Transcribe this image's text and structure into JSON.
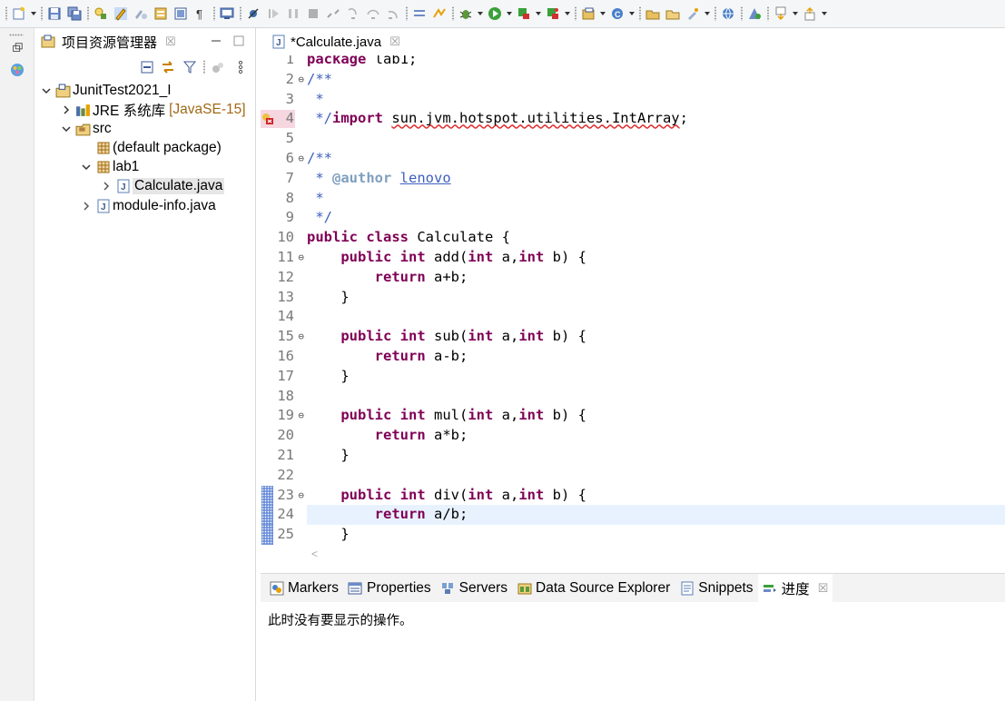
{
  "explorer": {
    "title": "项目资源管理器",
    "close": "☒"
  },
  "tree": [
    {
      "label": "JunitTest2021_I",
      "deco": ""
    },
    {
      "label": "JRE 系统库",
      "deco": "[JavaSE-15]"
    },
    {
      "label": "src",
      "deco": ""
    },
    {
      "label": "(default package)",
      "deco": ""
    },
    {
      "label": "lab1",
      "deco": ""
    },
    {
      "label": "Calculate.java",
      "deco": ""
    },
    {
      "label": "module-info.java",
      "deco": ""
    }
  ],
  "editor": {
    "tab_label": "*Calculate.java",
    "close": "☒",
    "lines": [
      {
        "n": "1",
        "fold": "",
        "marker": ""
      },
      {
        "n": "2",
        "fold": "⊖",
        "marker": ""
      },
      {
        "n": "3",
        "fold": "",
        "marker": ""
      },
      {
        "n": "4",
        "fold": "",
        "marker": "error"
      },
      {
        "n": "5",
        "fold": "",
        "marker": ""
      },
      {
        "n": "6",
        "fold": "⊖",
        "marker": ""
      },
      {
        "n": "7",
        "fold": "",
        "marker": ""
      },
      {
        "n": "8",
        "fold": "",
        "marker": ""
      },
      {
        "n": "9",
        "fold": "",
        "marker": ""
      },
      {
        "n": "10",
        "fold": "",
        "marker": ""
      },
      {
        "n": "11",
        "fold": "⊖",
        "marker": ""
      },
      {
        "n": "12",
        "fold": "",
        "marker": ""
      },
      {
        "n": "13",
        "fold": "",
        "marker": ""
      },
      {
        "n": "14",
        "fold": "",
        "marker": ""
      },
      {
        "n": "15",
        "fold": "⊖",
        "marker": ""
      },
      {
        "n": "16",
        "fold": "",
        "marker": ""
      },
      {
        "n": "17",
        "fold": "",
        "marker": ""
      },
      {
        "n": "18",
        "fold": "",
        "marker": ""
      },
      {
        "n": "19",
        "fold": "⊖",
        "marker": ""
      },
      {
        "n": "20",
        "fold": "",
        "marker": ""
      },
      {
        "n": "21",
        "fold": "",
        "marker": ""
      },
      {
        "n": "22",
        "fold": "",
        "marker": ""
      },
      {
        "n": "23",
        "fold": "⊖",
        "marker": "change"
      },
      {
        "n": "24",
        "fold": "",
        "marker": "change"
      },
      {
        "n": "25",
        "fold": "",
        "marker": "change"
      }
    ],
    "code": {
      "l1": {
        "kw": "package",
        "rest": " lab1;"
      },
      "l2": "/**",
      "l3": " *",
      "l4": {
        "cm": " */",
        "kw": "import",
        "sp": " ",
        "err": "sun.jvm.hotspot.utilities.IntArray",
        "end": ";"
      },
      "l5": "",
      "l6": "/**",
      "l7": {
        "pre": " * ",
        "tag": "@author",
        "sp": " ",
        "name": "lenovo"
      },
      "l8": " *",
      "l9": " */",
      "l10": {
        "kw1": "public",
        "kw2": "class",
        "rest": " Calculate {"
      },
      "l11": {
        "indent": "    ",
        "kw1": "public",
        "kw2": "int",
        "name": " add(",
        "kw3": "int",
        "a": " a,",
        "kw4": "int",
        "b": " b) {"
      },
      "l12": {
        "indent": "        ",
        "kw": "return",
        "expr": " a+b;"
      },
      "l13": "    }",
      "l14": "",
      "l15": {
        "indent": "    ",
        "kw1": "public",
        "kw2": "int",
        "name": " sub(",
        "kw3": "int",
        "a": " a,",
        "kw4": "int",
        "b": " b) {"
      },
      "l16": {
        "indent": "        ",
        "kw": "return",
        "expr": " a-b;"
      },
      "l17": "    }",
      "l18": "",
      "l19": {
        "indent": "    ",
        "kw1": "public",
        "kw2": "int",
        "name": " mul(",
        "kw3": "int",
        "a": " a,",
        "kw4": "int",
        "b": " b) {"
      },
      "l20": {
        "indent": "        ",
        "kw": "return",
        "expr": " a*b;"
      },
      "l21": "    }",
      "l22": "",
      "l23": {
        "indent": "    ",
        "kw1": "public",
        "kw2": "int",
        "name": " div(",
        "kw3": "int",
        "a": " a,",
        "kw4": "int",
        "b": " b) {"
      },
      "l24": {
        "indent": "        ",
        "kw": "return",
        "expr": " a/b;"
      },
      "l25": "    }"
    },
    "hscroll": "<"
  },
  "bottom": {
    "tabs": [
      {
        "label": "Markers"
      },
      {
        "label": "Properties"
      },
      {
        "label": "Servers"
      },
      {
        "label": "Data Source Explorer"
      },
      {
        "label": "Snippets"
      },
      {
        "label": "进度"
      }
    ],
    "close": "☒",
    "message": "此时没有要显示的操作。"
  },
  "colors": {
    "keyword": "#7f0055",
    "javadoc": "#3f5fbf",
    "javadoc_tag": "#7f9fbf",
    "error": "#e03030",
    "current_line": "#e8f2fe",
    "change_marker": "#6a8fd8"
  },
  "icons": {
    "toolbar": [
      "new-icon",
      "save-icon",
      "save-all-icon",
      "open-type-icon",
      "toggle-highlight-icon",
      "toggle-mark-icon",
      "external-tools-icon",
      "toggle-block-icon",
      "show-whitespace-icon",
      "console-icon",
      "skip-breakpoints-icon",
      "resume-icon",
      "suspend-icon",
      "terminate-icon",
      "disconnect-icon",
      "step-into-icon",
      "step-over-icon",
      "step-return-icon",
      "drop-to-frame-icon",
      "use-step-filters-icon",
      "debug-icon",
      "run-icon",
      "coverage-icon",
      "external-run-icon",
      "new-java-project-icon",
      "new-java-package-icon",
      "new-java-class-icon",
      "open-task-icon",
      "search-icon",
      "web-browser-icon",
      "next-annotation-icon",
      "previous-annotation-icon"
    ]
  }
}
